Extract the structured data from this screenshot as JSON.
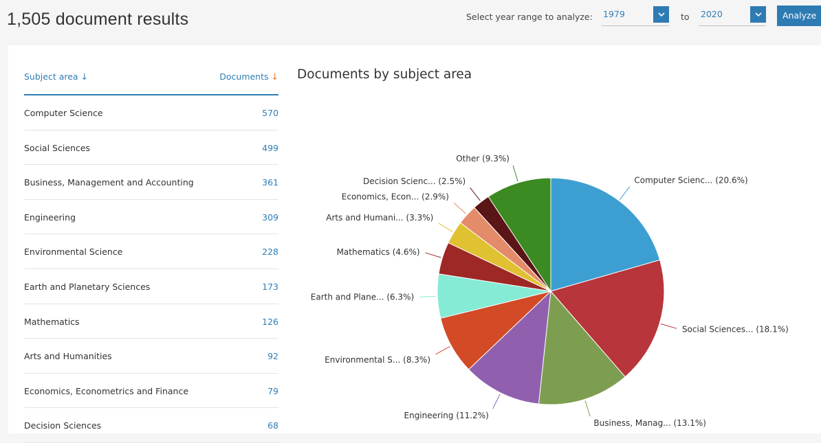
{
  "header": {
    "results_title": "1,505 document results",
    "year_prompt": "Select year range to analyze:",
    "year_from": "1979",
    "to_label": "to",
    "year_to": "2020",
    "analyze_label": "Analyze"
  },
  "table": {
    "col_subject": "Subject area",
    "col_documents": "Documents",
    "rows": [
      {
        "name": "Computer Science",
        "count": "570"
      },
      {
        "name": "Social Sciences",
        "count": "499"
      },
      {
        "name": "Business, Management and Accounting",
        "count": "361"
      },
      {
        "name": "Engineering",
        "count": "309"
      },
      {
        "name": "Environmental Science",
        "count": "228"
      },
      {
        "name": "Earth and Planetary Sciences",
        "count": "173"
      },
      {
        "name": "Mathematics",
        "count": "126"
      },
      {
        "name": "Arts and Humanities",
        "count": "92"
      },
      {
        "name": "Economics, Econometrics and Finance",
        "count": "79"
      },
      {
        "name": "Decision Sciences",
        "count": "68"
      }
    ]
  },
  "chart_data": {
    "type": "pie",
    "title": "Documents by subject area",
    "slices": [
      {
        "label": "Computer Scienc... (20.6%)",
        "value": 20.6,
        "color": "#3d9fd1"
      },
      {
        "label": "Social Sciences... (18.1%)",
        "value": 18.1,
        "color": "#b7353b"
      },
      {
        "label": "Business, Manag... (13.1%)",
        "value": 13.1,
        "color": "#7d9e50"
      },
      {
        "label": "Engineering (11.2%)",
        "value": 11.2,
        "color": "#9060ae"
      },
      {
        "label": "Environmental S... (8.3%)",
        "value": 8.3,
        "color": "#d24a26"
      },
      {
        "label": "Earth and Plane... (6.3%)",
        "value": 6.3,
        "color": "#85ebd5"
      },
      {
        "label": "Mathematics (4.6%)",
        "value": 4.6,
        "color": "#9e2826"
      },
      {
        "label": "Arts and Humani... (3.3%)",
        "value": 3.3,
        "color": "#e0c131"
      },
      {
        "label": "Economics, Econ... (2.9%)",
        "value": 2.9,
        "color": "#e48b69"
      },
      {
        "label": "Decision Scienc... (2.5%)",
        "value": 2.5,
        "color": "#5a1517"
      },
      {
        "label": "Other (9.3%)",
        "value": 9.3,
        "color": "#3b8a22"
      }
    ]
  }
}
